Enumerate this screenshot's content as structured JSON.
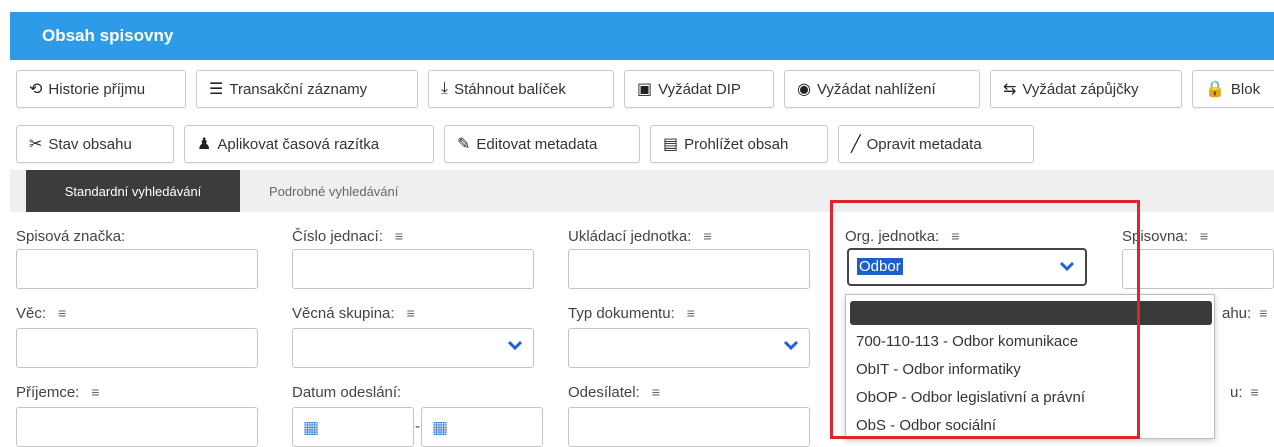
{
  "header": {
    "title": "Obsah spisovny"
  },
  "toolbar1": [
    {
      "label": "Historie příjmu",
      "icon": "history-icon",
      "glyph": "⟲"
    },
    {
      "label": "Transakční záznamy",
      "icon": "list-icon",
      "glyph": "☰"
    },
    {
      "label": "Stáhnout balíček",
      "icon": "download-icon",
      "glyph": "⤓"
    },
    {
      "label": "Vyžádat DIP",
      "icon": "package-icon",
      "glyph": "▣"
    },
    {
      "label": "Vyžádat nahlížení",
      "icon": "eye-icon",
      "glyph": "◉"
    },
    {
      "label": "Vyžádat zápůjčky",
      "icon": "exchange-icon",
      "glyph": "⇆"
    },
    {
      "label": "Blok",
      "icon": "lock-icon",
      "glyph": "🔒"
    }
  ],
  "toolbar2": [
    {
      "label": "Stav obsahu",
      "icon": "scissors-icon",
      "glyph": "✂"
    },
    {
      "label": "Aplikovat časová razítka",
      "icon": "stamp-user-icon",
      "glyph": "♟"
    },
    {
      "label": "Editovat metadata",
      "icon": "edit-icon",
      "glyph": "✎"
    },
    {
      "label": "Prohlížet obsah",
      "icon": "image-icon",
      "glyph": "▤"
    },
    {
      "label": "Opravit metadata",
      "icon": "pencil-icon",
      "glyph": "╱"
    }
  ],
  "tabs": {
    "standard": "Standardní vyhledávání",
    "advanced": "Podrobné vyhledávání"
  },
  "filter_icon": "≡",
  "fields": {
    "spisova_znacka": "Spisová značka:",
    "cislo_jednaci": "Číslo jednací:",
    "ukladaci_jednotka": "Ukládací jednotka:",
    "org_jednotka": "Org. jednotka:",
    "spisovna": "Spisovna:",
    "vec": "Věc:",
    "vecna_skupina": "Věcná skupina:",
    "typ_dokumentu": "Typ dokumentu:",
    "stav_obsahu_partial": "ahu:",
    "prijemce": "Příjemce:",
    "datum_odeslani": "Datum odeslání:",
    "odesilatel": "Odesílatel:",
    "partial_right": "u:"
  },
  "org_select": {
    "value": "Odbor",
    "options": [
      "700-110-113 - Odbor komunikace",
      "ObIT - Odbor informatiky",
      "ObOP - Odbor legislativní a právní",
      "ObS - Odbor sociální"
    ]
  },
  "date_dash": "-",
  "colors": {
    "header": "#2d9be8",
    "active_tab": "#3c3c3c",
    "highlight": "#e0242a",
    "chevron": "#1f63d6"
  }
}
